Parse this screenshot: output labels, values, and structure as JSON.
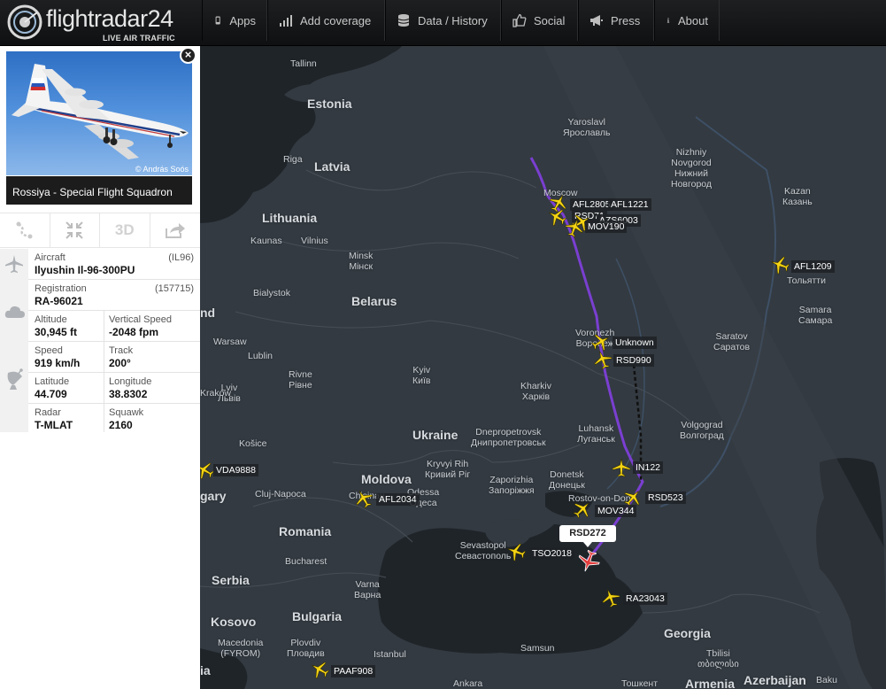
{
  "header": {
    "brand": "flightradar24",
    "tagline": "LIVE AIR TRAFFIC",
    "nav": [
      {
        "label": "Apps",
        "icon": "phone-icon"
      },
      {
        "label": "Add coverage",
        "icon": "signal-bars-icon"
      },
      {
        "label": "Data / History",
        "icon": "database-icon"
      },
      {
        "label": "Social",
        "icon": "thumbs-up-icon"
      },
      {
        "label": "Press",
        "icon": "megaphone-icon"
      },
      {
        "label": "About",
        "icon": "info-icon"
      }
    ]
  },
  "panel": {
    "photo_credit": "© András Soós",
    "airline": "Rossiya - Special Flight Squadron",
    "tools": [
      "route-icon",
      "shrink-icon",
      "3D",
      "share-icon"
    ],
    "aircraft": {
      "label": "Aircraft",
      "value": "Ilyushin Il-96-300PU",
      "code": "(IL96)"
    },
    "registration": {
      "label": "Registration",
      "value": "RA-96021",
      "code": "(157715)"
    },
    "altitude": {
      "label": "Altitude",
      "value": "30,945 ft"
    },
    "vertical_speed": {
      "label": "Vertical Speed",
      "value": "-2048 fpm"
    },
    "speed": {
      "label": "Speed",
      "value": "919 km/h"
    },
    "track": {
      "label": "Track",
      "value": "200°"
    },
    "latitude": {
      "label": "Latitude",
      "value": "44.709"
    },
    "longitude": {
      "label": "Longitude",
      "value": "38.8302"
    },
    "radar": {
      "label": "Radar",
      "value": "T-MLAT"
    },
    "squawk": {
      "label": "Squawk",
      "value": "2160"
    }
  },
  "map": {
    "selected_callsign": "RSD272",
    "countries": [
      "Estonia",
      "Latvia",
      "Lithuania",
      "Belarus",
      "Ukraine",
      "Moldova",
      "Romania",
      "Bulgaria",
      "Georgia",
      "Serbia",
      "Kosovo",
      "Azerbaijan",
      "Armenia",
      "nd",
      "gary",
      "ia"
    ],
    "places": [
      "Tallinn",
      "Riga",
      "Kaunas",
      "Vilnius",
      "Minsk\nМінск",
      "Bialystok",
      "Warsaw",
      "Lublin",
      "Lviv\nЛьвів",
      "Rivne\nРівне",
      "Kyiv\nКиїв",
      "Kharkiv\nХарків",
      "Yaroslavl\nЯрославль",
      "Nizhniy\nNovgorod\nНижний\nНовгород",
      "Kazan\nКазань",
      "Samara\nСамара",
      "Saratov\nСаратов",
      "Volgograd\nВолгоград",
      "Luhansk\nЛуганськ",
      "Dnepropetrovsk\nДнипропетровськ",
      "Kryvyi Rih\nКривий Ріг",
      "Zaporizhia\nЗапоріжжя",
      "Donetsk\nДонецьк",
      "Odessa\nОдеса",
      "Chisinau",
      "Cluj-Napoca",
      "Bucharest",
      "Sevastopol\nСевастополь",
      "Varna\nВарна",
      "Plovdiv\nПловдив",
      "Istanbul",
      "Samsun",
      "Ankara",
      "Tbilisi\nთბილისი",
      "Košice",
      "Kraków",
      "Macedonia\n(FYROM)",
      "Moscow",
      "Voronezh\nВоронеж",
      "Rostov-on-Don",
      "Baku",
      "Тольятти",
      "Тошкент"
    ],
    "flights": [
      {
        "callsign": "AFL2805"
      },
      {
        "callsign": "AFL1221"
      },
      {
        "callsign": "RSD71"
      },
      {
        "callsign": "AZS6003"
      },
      {
        "callsign": "MOV190"
      },
      {
        "callsign": "AFL1209"
      },
      {
        "callsign": "Unknown"
      },
      {
        "callsign": "RSD990"
      },
      {
        "callsign": "IN122"
      },
      {
        "callsign": "RSD523"
      },
      {
        "callsign": "MOV344"
      },
      {
        "callsign": "VDA9888"
      },
      {
        "callsign": "AFL2034"
      },
      {
        "callsign": "TSO2018"
      },
      {
        "callsign": "RA23043"
      },
      {
        "callsign": "PAAF908"
      }
    ]
  }
}
